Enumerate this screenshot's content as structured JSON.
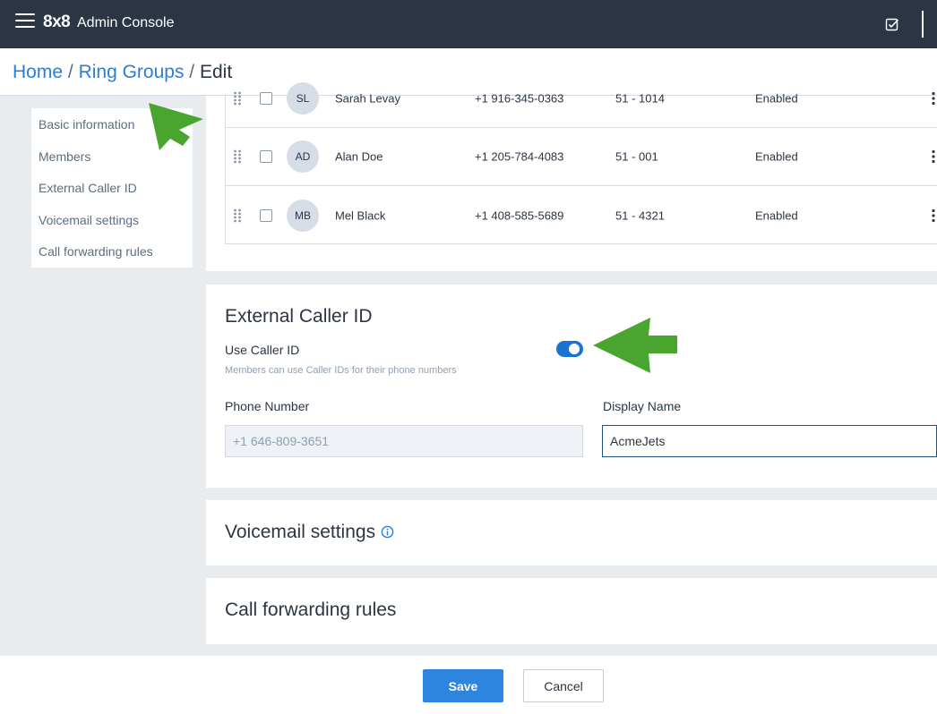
{
  "header": {
    "logo": "8x8",
    "app_title": "Admin Console"
  },
  "breadcrumb": {
    "home": "Home",
    "ring_groups": "Ring Groups",
    "current": "Edit",
    "separator": "/"
  },
  "sidebar": {
    "items": [
      {
        "label": "Basic information"
      },
      {
        "label": "Members"
      },
      {
        "label": "External Caller ID"
      },
      {
        "label": "Voicemail settings"
      },
      {
        "label": "Call forwarding rules"
      }
    ]
  },
  "members": {
    "rows": [
      {
        "initials": "SL",
        "name": "Sarah Levay",
        "phone": "+1 916-345-0363",
        "extension": "51 - 1014",
        "status": "Enabled"
      },
      {
        "initials": "AD",
        "name": "Alan Doe",
        "phone": "+1 205-784-4083",
        "extension": "51 - 001",
        "status": "Enabled"
      },
      {
        "initials": "MB",
        "name": "Mel Black",
        "phone": "+1 408-585-5689",
        "extension": "51 - 4321",
        "status": "Enabled"
      }
    ]
  },
  "caller_id": {
    "title": "External Caller ID",
    "toggle_label": "Use Caller ID",
    "toggle_on": true,
    "toggle_hint": "Members can use Caller IDs for their phone numbers",
    "phone_label": "Phone Number",
    "phone_value": "+1 646-809-3651",
    "display_name_label": "Display Name",
    "display_name_value": "AcmeJets"
  },
  "voicemail": {
    "title": "Voicemail settings"
  },
  "forwarding": {
    "title": "Call forwarding rules"
  },
  "footer": {
    "save_label": "Save",
    "cancel_label": "Cancel"
  },
  "colors": {
    "topbar": "#2c3544",
    "accent": "#2e85e0",
    "link": "#2e7dd1",
    "annotation": "#4aa52e"
  },
  "icons": {
    "menu": "hamburger-icon",
    "tasks": "checkbox-square-icon",
    "drag": "drag-handle-icon",
    "more": "kebab-menu-icon",
    "info": "info-icon"
  }
}
